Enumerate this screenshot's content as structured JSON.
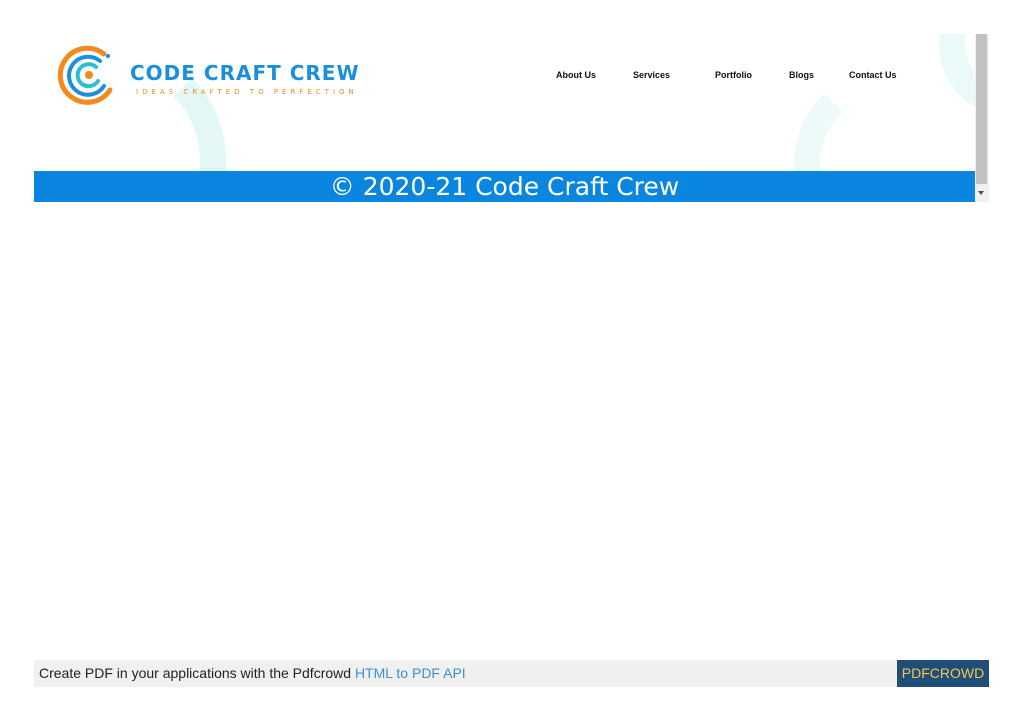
{
  "header": {
    "brand_name": "CODE CRAFT CREW",
    "tagline": "IDEAS CRAFTED TO PERFECTION",
    "nav": [
      {
        "label": "About Us"
      },
      {
        "label": "Services"
      },
      {
        "label": "Portfolio"
      },
      {
        "label": "Blogs"
      },
      {
        "label": "Contact Us"
      }
    ]
  },
  "footer": {
    "copyright": "© 2020-21 Code Craft Crew"
  },
  "pdf_banner": {
    "text_before_link": "Create PDF in your applications with the Pdfcrowd ",
    "link_text": "HTML to PDF API",
    "button_label": "PDFCROWD"
  },
  "colors": {
    "brand_blue": "#1a8fe0",
    "brand_orange": "#f28a1d",
    "footer_bar": "#0b86e0",
    "banner_button_bg": "#1f4e79",
    "banner_button_text": "#f6c453"
  },
  "icons": {
    "logo_mark": "concentric-c-logo-icon",
    "scroll_down": "scroll-down-arrow-icon"
  }
}
